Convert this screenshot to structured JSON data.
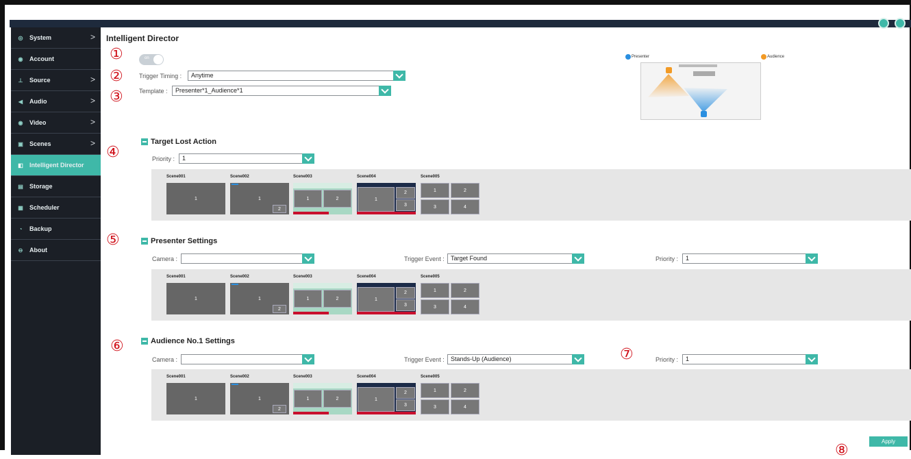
{
  "header": {
    "icons": [
      "user-icon",
      "logout-icon"
    ]
  },
  "sidebar": {
    "items": [
      {
        "label": "System",
        "icon": "gear-icon",
        "has_arrow": true
      },
      {
        "label": "Account",
        "icon": "account-icon",
        "has_arrow": false
      },
      {
        "label": "Source",
        "icon": "network-icon",
        "has_arrow": true
      },
      {
        "label": "Audio",
        "icon": "speaker-icon",
        "has_arrow": true
      },
      {
        "label": "Video",
        "icon": "video-icon",
        "has_arrow": true
      },
      {
        "label": "Scenes",
        "icon": "scenes-icon",
        "has_arrow": true
      },
      {
        "label": "Intelligent Director",
        "icon": "director-icon",
        "has_arrow": false,
        "active": true
      },
      {
        "label": "Storage",
        "icon": "storage-icon",
        "has_arrow": false
      },
      {
        "label": "Scheduler",
        "icon": "calendar-icon",
        "has_arrow": false
      },
      {
        "label": "Backup",
        "icon": "backup-icon",
        "has_arrow": false
      },
      {
        "label": "About",
        "icon": "info-icon",
        "has_arrow": false
      }
    ],
    "arrow_glyph": ">"
  },
  "main": {
    "title": "Intelligent Director",
    "markers": [
      "①",
      "②",
      "③",
      "④",
      "⑤",
      "⑥",
      "⑦",
      "⑧"
    ],
    "toggle": {
      "label": "on",
      "state": "on"
    },
    "trigger_timing": {
      "label": "Trigger Timing :",
      "value": "Anytime"
    },
    "template": {
      "label": "Template :",
      "value": "Presenter*1_Audience*1"
    },
    "diagram": {
      "presenter_label": "Presenter",
      "audience_label": "Audience",
      "presenter_color": "#2a8fe0",
      "audience_color": "#f29a25"
    },
    "target_lost": {
      "title": "Target Lost Action",
      "priority_label": "Priority :",
      "priority_value": "1"
    },
    "presenter": {
      "title": "Presenter Settings",
      "camera_label": "Camera :",
      "camera_value": "",
      "trigger_label": "Trigger Event :",
      "trigger_value": "Target Found",
      "priority_label": "Priority :",
      "priority_value": "1"
    },
    "audience": {
      "title": "Audience No.1 Settings",
      "camera_label": "Camera :",
      "camera_value": "",
      "trigger_label": "Trigger Event :",
      "trigger_value": "Stands-Up (Audience)",
      "priority_label": "Priority :",
      "priority_value": "1"
    },
    "scenes": {
      "names": [
        "Scene001",
        "Scene002",
        "Scene003",
        "Scene004",
        "Scene005"
      ],
      "cells": {
        "s1": [
          "1"
        ],
        "s2": [
          "1",
          "2"
        ],
        "s3": [
          "1",
          "2"
        ],
        "s4": [
          "1",
          "2",
          "3"
        ],
        "s5": [
          "1",
          "2",
          "3",
          "4"
        ]
      }
    },
    "apply_label": "Apply"
  },
  "colors": {
    "accent": "#3fb8a8",
    "sidebar_bg": "#1b1f26",
    "marker": "#d0121b"
  }
}
